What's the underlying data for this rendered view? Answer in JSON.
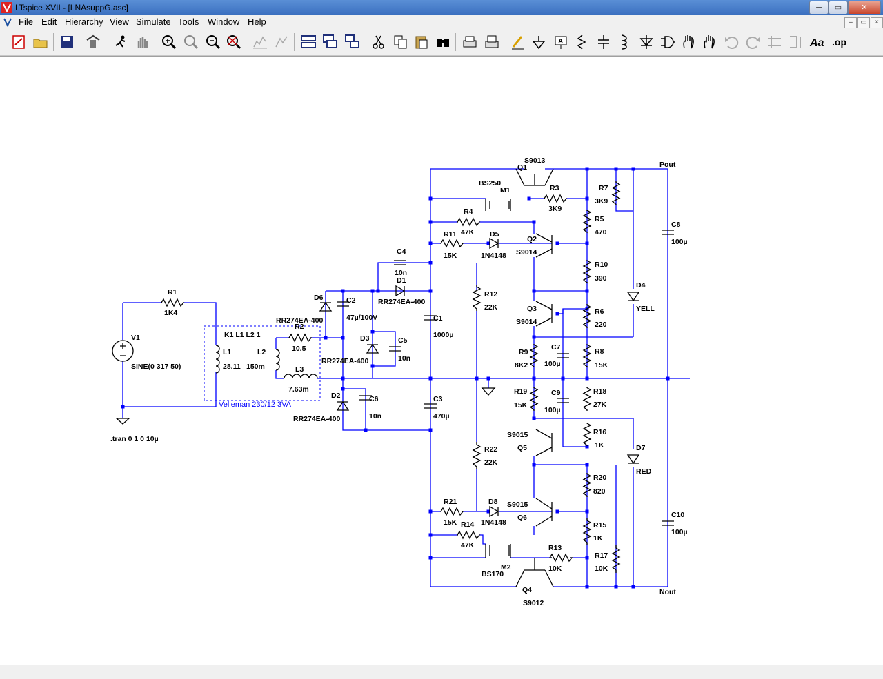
{
  "window": {
    "title": "LTspice XVII - [LNAsuppG.asc]",
    "min_glyph": "─",
    "max_glyph": "▭",
    "close_glyph": "✕"
  },
  "menu": {
    "items": [
      "File",
      "Edit",
      "Hierarchy",
      "View",
      "Simulate",
      "Tools",
      "Window",
      "Help"
    ]
  },
  "toolbar": {
    "icons": [
      "new-schematic-icon",
      "open-icon",
      "save-icon",
      "control-panel-icon",
      "run-icon",
      "halt-icon",
      "zoom-in-icon",
      "zoom-pan-icon",
      "zoom-out-icon",
      "zoom-fit-icon",
      "autorange-icon",
      "mark-unreferenced-icon",
      "tile-horizontal-icon",
      "cascade-icon",
      "close-windows-icon",
      "cut-icon",
      "copy-icon",
      "paste-icon",
      "find-icon",
      "print-icon",
      "print-setup-icon",
      "draw-wire-icon",
      "ground-icon",
      "label-net-icon",
      "resistor-icon",
      "capacitor-icon",
      "inductor-icon",
      "diode-icon",
      "component-icon",
      "move-icon",
      "drag-icon",
      "undo-icon",
      "redo-icon",
      "rotate-icon",
      "mirror-icon",
      "text-icon",
      "spice-directive-icon"
    ]
  },
  "schematic": {
    "labels": {
      "R1": "R1",
      "R1v": "1K4",
      "V1": "V1",
      "V1v": "SINE(0 317 50)",
      "tran": ".tran 0 1 0 10µ",
      "K1": "K1 L1 L2 1",
      "L1": "L1",
      "L1v": "28.11",
      "L2": "L2",
      "L2v": "150m",
      "L3": "L3",
      "L3v": "7.63m",
      "R2": "R2",
      "R2v": "10.5",
      "xfmr": "Velleman 230/12 3VA",
      "D6": "D6",
      "D6v": "RR274EA-400",
      "D2": "D2",
      "D2v": "RR274EA-400",
      "D3": "D3",
      "D3v": "RR274EA-400",
      "C2": "C2",
      "C2v": "47µ/100V",
      "C5": "C5",
      "C5v": "10n",
      "C6": "C6",
      "C6v": "10n",
      "C4": "C4",
      "C4v": "10n",
      "D1": "D1",
      "D1v": "RR274EA-400",
      "C1": "C1",
      "C1v": "1000µ",
      "C3": "C3",
      "C3v": "470µ",
      "Q1": "Q1",
      "Q1v": "S9013",
      "M1": "M1",
      "M1v": "BS250",
      "R3": "R3",
      "R3v": "3K9",
      "R4": "R4",
      "R4v": "47K",
      "R11": "R11",
      "R11v": "15K",
      "D5": "D5",
      "D5v": "1N4148",
      "Q2": "Q2",
      "Q2v": "S9014",
      "R12": "R12",
      "R12v": "22K",
      "Q3": "Q3",
      "Q3v": "S9014",
      "R5": "R5",
      "R5v": "470",
      "R7": "R7",
      "R7v": "3K9",
      "R10": "R10",
      "R10v": "390",
      "R6": "R6",
      "R6v": "220",
      "R8": "R8",
      "R8v": "15K",
      "R9": "R9",
      "R9v": "8K2",
      "C7": "C7",
      "C7v": "100µ",
      "D4": "D4",
      "D4v": "YELL",
      "C8": "C8",
      "C8v": "100µ",
      "R19": "R19",
      "R19v": "15K",
      "C9": "C9",
      "C9v": "100µ",
      "R18": "R18",
      "R18v": "27K",
      "Q5": "Q5",
      "Q5v": "S9015",
      "R16": "R16",
      "R16v": "1K",
      "D7": "D7",
      "D7v": "RED",
      "R22": "R22",
      "R22v": "22K",
      "R20": "R20",
      "R20v": "820",
      "R21": "R21",
      "R21v": "15K",
      "D8": "D8",
      "D8v": "1N4148",
      "Q6": "Q6",
      "Q6v": "S9015",
      "R14": "R14",
      "R14v": "47K",
      "R15": "R15",
      "R15v": "1K",
      "C10": "C10",
      "C10v": "100µ",
      "M2": "M2",
      "M2v": "BS170",
      "R13": "R13",
      "R13v": "10K",
      "R17": "R17",
      "R17v": "10K",
      "Q4": "Q4",
      "Q4v": "S9012",
      "Pout": "Pout",
      "Nout": "Nout"
    },
    "colors": {
      "wire": "#0000ff",
      "component": "#000000",
      "junction": "#0000ff",
      "annotation": "#0000ff"
    }
  }
}
